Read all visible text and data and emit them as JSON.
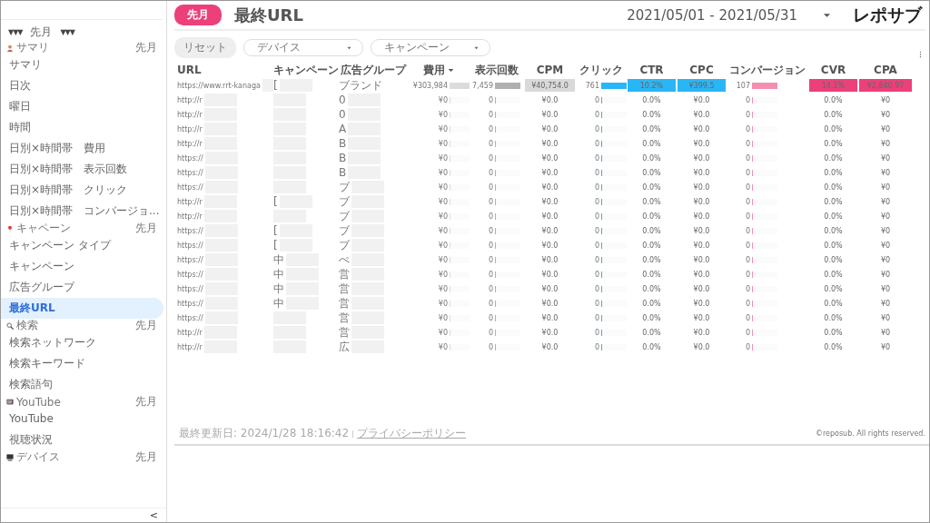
{
  "sidebar": {
    "period_selector": {
      "left": "▼▼▼",
      "label": "先月",
      "right": "▼▼▼"
    },
    "sections": [
      {
        "kind": "person",
        "label": "サマリ",
        "period": "先月",
        "items": [
          {
            "label": "サマリ",
            "selected": false
          },
          {
            "label": "日次",
            "selected": false
          },
          {
            "label": "曜日",
            "selected": false
          },
          {
            "label": "時間",
            "selected": false
          },
          {
            "label": "日別×時間帯　費用",
            "selected": false
          },
          {
            "label": "日別×時間帯　表示回数",
            "selected": false
          },
          {
            "label": "日別×時間帯　クリック",
            "selected": false
          },
          {
            "label": "日別×時間帯　コンバージョ...",
            "selected": false
          }
        ]
      },
      {
        "kind": "pin",
        "label": "キャペーン",
        "period": "先月",
        "items": [
          {
            "label": "キャンペーン タイプ",
            "selected": false
          },
          {
            "label": "キャンペーン",
            "selected": false
          },
          {
            "label": "広告グループ",
            "selected": false
          },
          {
            "label": "最終URL",
            "selected": true
          }
        ]
      },
      {
        "kind": "search",
        "label": "検索",
        "period": "先月",
        "items": [
          {
            "label": "検索ネットワーク",
            "selected": false
          },
          {
            "label": "検索キーワード",
            "selected": false
          },
          {
            "label": "検索語句",
            "selected": false
          }
        ]
      },
      {
        "kind": "tv",
        "label": "YouTube",
        "period": "先月",
        "items": [
          {
            "label": "YouTube",
            "selected": false
          },
          {
            "label": "視聴状況",
            "selected": false
          }
        ]
      },
      {
        "kind": "monitor",
        "label": "デバイス",
        "period": "先月"
      }
    ],
    "collapse": "<"
  },
  "header": {
    "period_badge": "先月",
    "title": "最終URL",
    "date_range": "2021/05/01 - 2021/05/31",
    "logo": "レポサブ"
  },
  "filters": {
    "reset": "リセット",
    "dropdowns": [
      {
        "label": "デバイス"
      },
      {
        "label": "キャンペーン"
      }
    ]
  },
  "table": {
    "columns": [
      {
        "label": "URL",
        "kind": "text"
      },
      {
        "label": "キャンペーン",
        "kind": "text"
      },
      {
        "label": "広告グループ",
        "kind": "text"
      },
      {
        "label": "費用",
        "kind": "bar",
        "color": "#dcdcdc",
        "sorted": true
      },
      {
        "label": "表示回数",
        "kind": "bar",
        "color": "#b0b0b0",
        "sorted": false
      },
      {
        "label": "CPM",
        "kind": "heat",
        "color": "#d9d9d9",
        "sorted": false
      },
      {
        "label": "クリック",
        "kind": "bar",
        "color": "#29b6f6",
        "sorted": false
      },
      {
        "label": "CTR",
        "kind": "heat",
        "color": "#29b6f6",
        "sorted": false
      },
      {
        "label": "CPC",
        "kind": "heat",
        "color": "#29b6f6",
        "sorted": false
      },
      {
        "label": "コンバージョン",
        "kind": "bar",
        "color": "#f48fb1",
        "sorted": false
      },
      {
        "label": "CVR",
        "kind": "heat",
        "color": "#ec407a",
        "sorted": false
      },
      {
        "label": "CPA",
        "kind": "heat",
        "color": "#ec407a",
        "sorted": false
      }
    ],
    "rows": [
      {
        "cells": [
          {
            "text": "https://www.rrt-kanaga"
          },
          {
            "text": "["
          },
          {
            "text": "ブランド"
          },
          {
            "text": "¥303,984",
            "level": 1
          },
          {
            "text": "7,459",
            "level": 1
          },
          {
            "text": "¥40,754.0",
            "highlight": true
          },
          {
            "text": "761",
            "level": 1
          },
          {
            "text": "10.2%",
            "highlight": true
          },
          {
            "text": "¥399.5",
            "highlight": true
          },
          {
            "text": "107",
            "level": 1
          },
          {
            "text": "14.1%",
            "highlight": true
          },
          {
            "text": "¥2,840.97",
            "highlight": true
          }
        ]
      },
      {
        "cells": [
          {
            "text": "http://r"
          },
          {
            "text": ""
          },
          {
            "text": "0"
          },
          {
            "text": "¥0",
            "level": 0
          },
          {
            "text": "0",
            "level": 0
          },
          {
            "text": "¥0.0",
            "highlight": false
          },
          {
            "text": "0",
            "level": 0
          },
          {
            "text": "0.0%",
            "highlight": false
          },
          {
            "text": "¥0.0",
            "highlight": false
          },
          {
            "text": "0",
            "level": 0
          },
          {
            "text": "0.0%",
            "highlight": false
          },
          {
            "text": "¥0",
            "highlight": false
          }
        ]
      },
      {
        "cells": [
          {
            "text": "http://r"
          },
          {
            "text": ""
          },
          {
            "text": "0"
          },
          {
            "text": "¥0",
            "level": 0
          },
          {
            "text": "0",
            "level": 0
          },
          {
            "text": "¥0.0",
            "highlight": false
          },
          {
            "text": "0",
            "level": 0
          },
          {
            "text": "0.0%",
            "highlight": false
          },
          {
            "text": "¥0.0",
            "highlight": false
          },
          {
            "text": "0",
            "level": 0
          },
          {
            "text": "0.0%",
            "highlight": false
          },
          {
            "text": "¥0",
            "highlight": false
          }
        ]
      },
      {
        "cells": [
          {
            "text": "http://r"
          },
          {
            "text": ""
          },
          {
            "text": "A"
          },
          {
            "text": "¥0",
            "level": 0
          },
          {
            "text": "0",
            "level": 0
          },
          {
            "text": "¥0.0",
            "highlight": false
          },
          {
            "text": "0",
            "level": 0
          },
          {
            "text": "0.0%",
            "highlight": false
          },
          {
            "text": "¥0.0",
            "highlight": false
          },
          {
            "text": "0",
            "level": 0
          },
          {
            "text": "0.0%",
            "highlight": false
          },
          {
            "text": "¥0",
            "highlight": false
          }
        ]
      },
      {
        "cells": [
          {
            "text": "http://r"
          },
          {
            "text": ""
          },
          {
            "text": "B"
          },
          {
            "text": "¥0",
            "level": 0
          },
          {
            "text": "0",
            "level": 0
          },
          {
            "text": "¥0.0",
            "highlight": false
          },
          {
            "text": "0",
            "level": 0
          },
          {
            "text": "0.0%",
            "highlight": false
          },
          {
            "text": "¥0.0",
            "highlight": false
          },
          {
            "text": "0",
            "level": 0
          },
          {
            "text": "0.0%",
            "highlight": false
          },
          {
            "text": "¥0",
            "highlight": false
          }
        ]
      },
      {
        "cells": [
          {
            "text": "https://"
          },
          {
            "text": ""
          },
          {
            "text": "B"
          },
          {
            "text": "¥0",
            "level": 0
          },
          {
            "text": "0",
            "level": 0
          },
          {
            "text": "¥0.0",
            "highlight": false
          },
          {
            "text": "0",
            "level": 0
          },
          {
            "text": "0.0%",
            "highlight": false
          },
          {
            "text": "¥0.0",
            "highlight": false
          },
          {
            "text": "0",
            "level": 0
          },
          {
            "text": "0.0%",
            "highlight": false
          },
          {
            "text": "¥0",
            "highlight": false
          }
        ]
      },
      {
        "cells": [
          {
            "text": "https://"
          },
          {
            "text": ""
          },
          {
            "text": "B"
          },
          {
            "text": "¥0",
            "level": 0
          },
          {
            "text": "0",
            "level": 0
          },
          {
            "text": "¥0.0",
            "highlight": false
          },
          {
            "text": "0",
            "level": 0
          },
          {
            "text": "0.0%",
            "highlight": false
          },
          {
            "text": "¥0.0",
            "highlight": false
          },
          {
            "text": "0",
            "level": 0
          },
          {
            "text": "0.0%",
            "highlight": false
          },
          {
            "text": "¥0",
            "highlight": false
          }
        ]
      },
      {
        "cells": [
          {
            "text": "https://"
          },
          {
            "text": ""
          },
          {
            "text": "ブ"
          },
          {
            "text": "¥0",
            "level": 0
          },
          {
            "text": "0",
            "level": 0
          },
          {
            "text": "¥0.0",
            "highlight": false
          },
          {
            "text": "0",
            "level": 0
          },
          {
            "text": "0.0%",
            "highlight": false
          },
          {
            "text": "¥0.0",
            "highlight": false
          },
          {
            "text": "0",
            "level": 0
          },
          {
            "text": "0.0%",
            "highlight": false
          },
          {
            "text": "¥0",
            "highlight": false
          }
        ]
      },
      {
        "cells": [
          {
            "text": "http://r"
          },
          {
            "text": "["
          },
          {
            "text": "ブ"
          },
          {
            "text": "¥0",
            "level": 0
          },
          {
            "text": "0",
            "level": 0
          },
          {
            "text": "¥0.0",
            "highlight": false
          },
          {
            "text": "0",
            "level": 0
          },
          {
            "text": "0.0%",
            "highlight": false
          },
          {
            "text": "¥0.0",
            "highlight": false
          },
          {
            "text": "0",
            "level": 0
          },
          {
            "text": "0.0%",
            "highlight": false
          },
          {
            "text": "¥0",
            "highlight": false
          }
        ]
      },
      {
        "cells": [
          {
            "text": "http://r"
          },
          {
            "text": ""
          },
          {
            "text": "ブ"
          },
          {
            "text": "¥0",
            "level": 0
          },
          {
            "text": "0",
            "level": 0
          },
          {
            "text": "¥0.0",
            "highlight": false
          },
          {
            "text": "0",
            "level": 0
          },
          {
            "text": "0.0%",
            "highlight": false
          },
          {
            "text": "¥0.0",
            "highlight": false
          },
          {
            "text": "0",
            "level": 0
          },
          {
            "text": "0.0%",
            "highlight": false
          },
          {
            "text": "¥0",
            "highlight": false
          }
        ]
      },
      {
        "cells": [
          {
            "text": "https://"
          },
          {
            "text": "["
          },
          {
            "text": "ブ"
          },
          {
            "text": "¥0",
            "level": 0
          },
          {
            "text": "0",
            "level": 0
          },
          {
            "text": "¥0.0",
            "highlight": false
          },
          {
            "text": "0",
            "level": 0
          },
          {
            "text": "0.0%",
            "highlight": false
          },
          {
            "text": "¥0.0",
            "highlight": false
          },
          {
            "text": "0",
            "level": 0
          },
          {
            "text": "0.0%",
            "highlight": false
          },
          {
            "text": "¥0",
            "highlight": false
          }
        ]
      },
      {
        "cells": [
          {
            "text": "https://"
          },
          {
            "text": "["
          },
          {
            "text": "ブ"
          },
          {
            "text": "¥0",
            "level": 0
          },
          {
            "text": "0",
            "level": 0
          },
          {
            "text": "¥0.0",
            "highlight": false
          },
          {
            "text": "0",
            "level": 0
          },
          {
            "text": "0.0%",
            "highlight": false
          },
          {
            "text": "¥0.0",
            "highlight": false
          },
          {
            "text": "0",
            "level": 0
          },
          {
            "text": "0.0%",
            "highlight": false
          },
          {
            "text": "¥0",
            "highlight": false
          }
        ]
      },
      {
        "cells": [
          {
            "text": "https://"
          },
          {
            "text": "中"
          },
          {
            "text": "ぺ"
          },
          {
            "text": "¥0",
            "level": 0
          },
          {
            "text": "0",
            "level": 0
          },
          {
            "text": "¥0.0",
            "highlight": false
          },
          {
            "text": "0",
            "level": 0
          },
          {
            "text": "0.0%",
            "highlight": false
          },
          {
            "text": "¥0.0",
            "highlight": false
          },
          {
            "text": "0",
            "level": 0
          },
          {
            "text": "0.0%",
            "highlight": false
          },
          {
            "text": "¥0",
            "highlight": false
          }
        ]
      },
      {
        "cells": [
          {
            "text": "https://"
          },
          {
            "text": "中"
          },
          {
            "text": "営"
          },
          {
            "text": "¥0",
            "level": 0
          },
          {
            "text": "0",
            "level": 0
          },
          {
            "text": "¥0.0",
            "highlight": false
          },
          {
            "text": "0",
            "level": 0
          },
          {
            "text": "0.0%",
            "highlight": false
          },
          {
            "text": "¥0.0",
            "highlight": false
          },
          {
            "text": "0",
            "level": 0
          },
          {
            "text": "0.0%",
            "highlight": false
          },
          {
            "text": "¥0",
            "highlight": false
          }
        ]
      },
      {
        "cells": [
          {
            "text": "https://"
          },
          {
            "text": "中"
          },
          {
            "text": "営"
          },
          {
            "text": "¥0",
            "level": 0
          },
          {
            "text": "0",
            "level": 0
          },
          {
            "text": "¥0.0",
            "highlight": false
          },
          {
            "text": "0",
            "level": 0
          },
          {
            "text": "0.0%",
            "highlight": false
          },
          {
            "text": "¥0.0",
            "highlight": false
          },
          {
            "text": "0",
            "level": 0
          },
          {
            "text": "0.0%",
            "highlight": false
          },
          {
            "text": "¥0",
            "highlight": false
          }
        ]
      },
      {
        "cells": [
          {
            "text": "https://"
          },
          {
            "text": "中"
          },
          {
            "text": "営"
          },
          {
            "text": "¥0",
            "level": 0
          },
          {
            "text": "0",
            "level": 0
          },
          {
            "text": "¥0.0",
            "highlight": false
          },
          {
            "text": "0",
            "level": 0
          },
          {
            "text": "0.0%",
            "highlight": false
          },
          {
            "text": "¥0.0",
            "highlight": false
          },
          {
            "text": "0",
            "level": 0
          },
          {
            "text": "0.0%",
            "highlight": false
          },
          {
            "text": "¥0",
            "highlight": false
          }
        ]
      },
      {
        "cells": [
          {
            "text": "https://"
          },
          {
            "text": ""
          },
          {
            "text": "営"
          },
          {
            "text": "¥0",
            "level": 0
          },
          {
            "text": "0",
            "level": 0
          },
          {
            "text": "¥0.0",
            "highlight": false
          },
          {
            "text": "0",
            "level": 0
          },
          {
            "text": "0.0%",
            "highlight": false
          },
          {
            "text": "¥0.0",
            "highlight": false
          },
          {
            "text": "0",
            "level": 0
          },
          {
            "text": "0.0%",
            "highlight": false
          },
          {
            "text": "¥0",
            "highlight": false
          }
        ]
      },
      {
        "cells": [
          {
            "text": "http://r"
          },
          {
            "text": ""
          },
          {
            "text": "営"
          },
          {
            "text": "¥0",
            "level": 0
          },
          {
            "text": "0",
            "level": 0
          },
          {
            "text": "¥0.0",
            "highlight": false
          },
          {
            "text": "0",
            "level": 0
          },
          {
            "text": "0.0%",
            "highlight": false
          },
          {
            "text": "¥0.0",
            "highlight": false
          },
          {
            "text": "0",
            "level": 0
          },
          {
            "text": "0.0%",
            "highlight": false
          },
          {
            "text": "¥0",
            "highlight": false
          }
        ]
      },
      {
        "cells": [
          {
            "text": "http://r"
          },
          {
            "text": ""
          },
          {
            "text": "広"
          },
          {
            "text": "¥0",
            "level": 0
          },
          {
            "text": "0",
            "level": 0
          },
          {
            "text": "¥0.0",
            "highlight": false
          },
          {
            "text": "0",
            "level": 0
          },
          {
            "text": "0.0%",
            "highlight": false
          },
          {
            "text": "¥0.0",
            "highlight": false
          },
          {
            "text": "0",
            "level": 0
          },
          {
            "text": "0.0%",
            "highlight": false
          },
          {
            "text": "¥0",
            "highlight": false
          }
        ]
      }
    ]
  },
  "footer": {
    "updated": "最終更新日: 2024/1/28 18:16:42",
    "privacy_link": "プライバシーポリシー",
    "copyright": "©reposub. All rights reserved."
  }
}
